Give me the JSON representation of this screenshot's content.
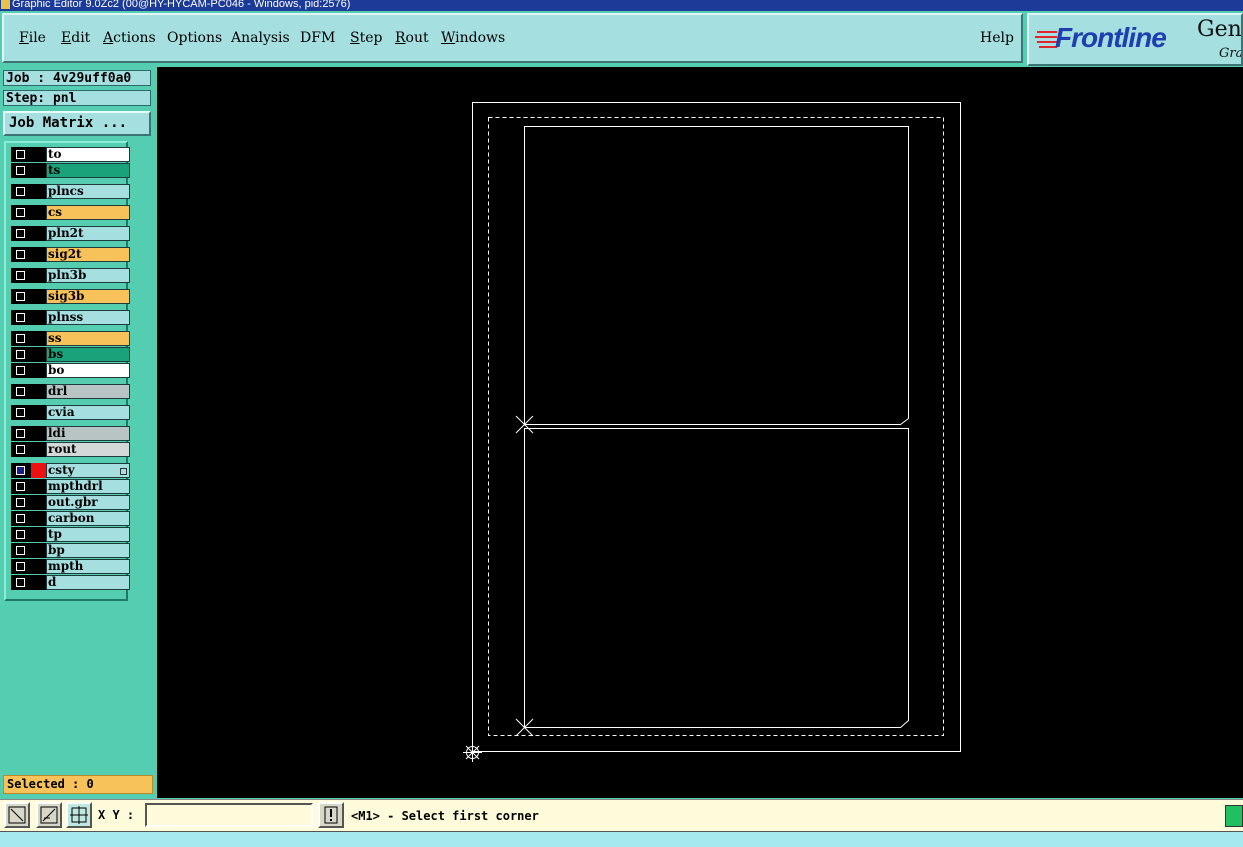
{
  "window": {
    "title": "Graphic Editor 9.0Zc2 (00@HY-HYCAM-PC046 - Windows, pid:2576)"
  },
  "menu": {
    "items": [
      {
        "label": "File",
        "key": "F",
        "rest": "ile"
      },
      {
        "label": "Edit",
        "key": "E",
        "rest": "dit"
      },
      {
        "label": "Actions",
        "key": "A",
        "rest": "ctions"
      },
      {
        "label": "Options",
        "key": "",
        "rest": "Options"
      },
      {
        "label": "Analysis",
        "key": "",
        "rest": "Analysis"
      },
      {
        "label": "DFM",
        "key": "",
        "rest": "DFM"
      },
      {
        "label": "Step",
        "key": "S",
        "rest": "tep"
      },
      {
        "label": "Rout",
        "key": "R",
        "rest": "out"
      },
      {
        "label": "Windows",
        "key": "W",
        "rest": "indows"
      }
    ],
    "help": "Help"
  },
  "logo": {
    "brand": "Frontline",
    "product": "Gene",
    "subtitle": "Gra"
  },
  "job": {
    "label": "Job : 4v29uff0a0",
    "step": "Step: pnl",
    "matrix_button": "Job Matrix ..."
  },
  "layers": [
    {
      "name": "to",
      "color": "#ffffff"
    },
    {
      "name": "ts",
      "color": "#1aa37a"
    },
    {
      "name": "plncs",
      "color": "#a6dfe0"
    },
    {
      "name": "cs",
      "color": "#f8c25a"
    },
    {
      "name": "pln2t",
      "color": "#a6dfe0"
    },
    {
      "name": "sig2t",
      "color": "#f8c25a"
    },
    {
      "name": "pln3b",
      "color": "#a6dfe0"
    },
    {
      "name": "sig3b",
      "color": "#f8c25a"
    },
    {
      "name": "plnss",
      "color": "#a6dfe0"
    },
    {
      "name": "ss",
      "color": "#f8c25a"
    },
    {
      "name": "bs",
      "color": "#1aa37a"
    },
    {
      "name": "bo",
      "color": "#ffffff"
    },
    {
      "name": "drl",
      "color": "#b8c4c4"
    },
    {
      "name": "cvia",
      "color": "#a6dfe0"
    },
    {
      "name": "ldi",
      "color": "#b8c4c4"
    },
    {
      "name": "rout",
      "color": "#d4d8d8"
    },
    {
      "name": "csty",
      "color": "#a6dfe0",
      "active": true
    },
    {
      "name": "mpthdrl",
      "color": "#a6dfe0"
    },
    {
      "name": "out.gbr",
      "color": "#a6dfe0"
    },
    {
      "name": "carbon",
      "color": "#a6dfe0"
    },
    {
      "name": "tp",
      "color": "#a6dfe0"
    },
    {
      "name": "bp",
      "color": "#a6dfe0"
    },
    {
      "name": "mpth",
      "color": "#a6dfe0"
    },
    {
      "name": "d",
      "color": "#a6dfe0"
    }
  ],
  "selected": "Selected : 0",
  "bottom": {
    "xy_label": "X Y :",
    "xy_value": "",
    "status": "<M1> - Select first corner"
  }
}
